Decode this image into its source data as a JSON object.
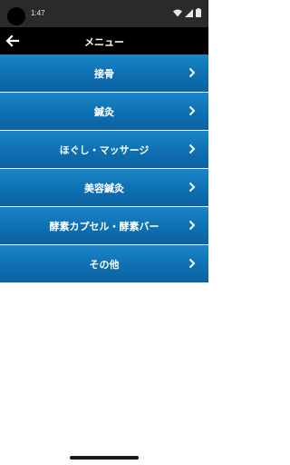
{
  "status_bar": {
    "time": "1:47",
    "icons": [
      "wifi-icon",
      "cellular-icon",
      "battery-icon"
    ]
  },
  "app_bar": {
    "title": "メニュー",
    "back_icon": "arrow-left-icon"
  },
  "menu": {
    "items": [
      {
        "label": "接骨"
      },
      {
        "label": "鍼灸"
      },
      {
        "label": "ほぐし・マッサージ"
      },
      {
        "label": "美容鍼灸"
      },
      {
        "label": "酵素カプセル・酵素バー"
      },
      {
        "label": "その他"
      }
    ]
  },
  "colors": {
    "menu_bg": "#0e6fb1",
    "app_bar_bg": "#000000",
    "status_bar_bg": "#2a2a2a"
  }
}
